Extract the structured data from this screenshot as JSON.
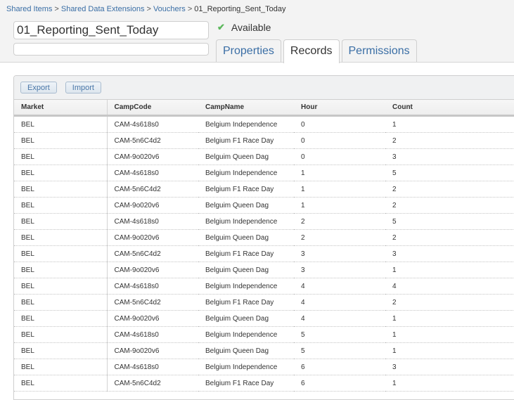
{
  "breadcrumb": {
    "items": [
      "Shared Items",
      "Shared Data Extensions",
      "Vouchers"
    ],
    "separator": ">",
    "current": "01_Reporting_Sent_Today"
  },
  "name_field": {
    "value": "01_Reporting_Sent_Today"
  },
  "description_field": {
    "value": ""
  },
  "status": {
    "icon": "check-icon",
    "label": "Available",
    "color": "#5cb85c"
  },
  "tabs": [
    {
      "label": "Properties",
      "active": false
    },
    {
      "label": "Records",
      "active": true
    },
    {
      "label": "Permissions",
      "active": false
    }
  ],
  "toolbar": {
    "export_label": "Export",
    "import_label": "Import"
  },
  "table": {
    "columns": [
      "Market",
      "CampCode",
      "CampName",
      "Hour",
      "Count"
    ],
    "rows": [
      [
        "BEL",
        "CAM-4s618s0",
        "Belgium Independence",
        "0",
        "1"
      ],
      [
        "BEL",
        "CAM-5n6C4d2",
        "Belgium F1 Race Day",
        "0",
        "2"
      ],
      [
        "BEL",
        "CAM-9o020v6",
        "Belguim Queen Dag",
        "0",
        "3"
      ],
      [
        "BEL",
        "CAM-4s618s0",
        "Belgium Independence",
        "1",
        "5"
      ],
      [
        "BEL",
        "CAM-5n6C4d2",
        "Belgium F1 Race Day",
        "1",
        "2"
      ],
      [
        "BEL",
        "CAM-9o020v6",
        "Belguim Queen Dag",
        "1",
        "2"
      ],
      [
        "BEL",
        "CAM-4s618s0",
        "Belgium Independence",
        "2",
        "5"
      ],
      [
        "BEL",
        "CAM-9o020v6",
        "Belguim Queen Dag",
        "2",
        "2"
      ],
      [
        "BEL",
        "CAM-5n6C4d2",
        "Belgium F1 Race Day",
        "3",
        "3"
      ],
      [
        "BEL",
        "CAM-9o020v6",
        "Belguim Queen Dag",
        "3",
        "1"
      ],
      [
        "BEL",
        "CAM-4s618s0",
        "Belgium Independence",
        "4",
        "4"
      ],
      [
        "BEL",
        "CAM-5n6C4d2",
        "Belgium F1 Race Day",
        "4",
        "2"
      ],
      [
        "BEL",
        "CAM-9o020v6",
        "Belguim Queen Dag",
        "4",
        "1"
      ],
      [
        "BEL",
        "CAM-4s618s0",
        "Belgium Independence",
        "5",
        "1"
      ],
      [
        "BEL",
        "CAM-9o020v6",
        "Belguim Queen Dag",
        "5",
        "1"
      ],
      [
        "BEL",
        "CAM-4s618s0",
        "Belgium Independence",
        "6",
        "3"
      ],
      [
        "BEL",
        "CAM-5n6C4d2",
        "Belgium F1 Race Day",
        "6",
        "1"
      ]
    ]
  }
}
